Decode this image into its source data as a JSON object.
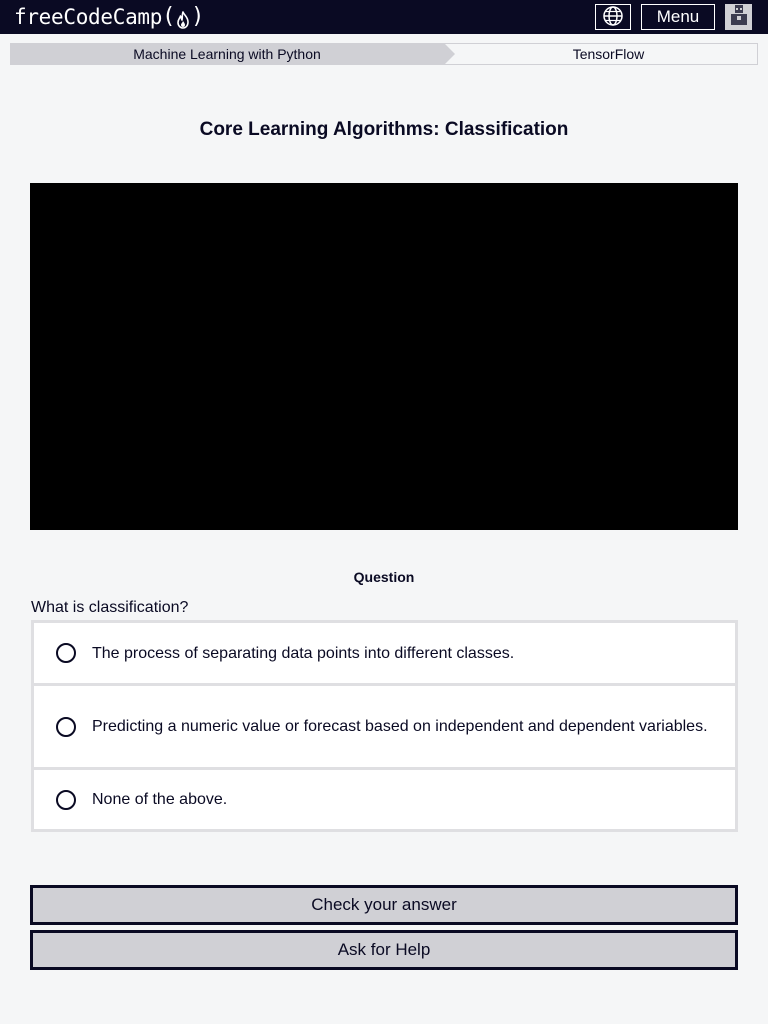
{
  "nav": {
    "logo_text": "freeCodeCamp",
    "logo_paren_open": "(",
    "logo_paren_close": ")",
    "logo_icon": "flame-icon",
    "language_icon": "globe-icon",
    "menu_label": "Menu",
    "avatar_icon": "avatar-icon"
  },
  "breadcrumb": {
    "course": "Machine Learning with Python",
    "lesson": "TensorFlow"
  },
  "title": "Core Learning Algorithms: Classification",
  "video": {
    "color": "#000000"
  },
  "question": {
    "heading": "Question",
    "text": "What is classification?",
    "answers": [
      {
        "label": "The process of separating data points into different classes.",
        "selected": false
      },
      {
        "label": "Predicting a numeric value or forecast based on independent and dependent variables.",
        "selected": false
      },
      {
        "label": "None of the above.",
        "selected": false
      }
    ]
  },
  "buttons": {
    "check": "Check your answer",
    "help": "Ask for Help"
  },
  "colors": {
    "nav_bg": "#0a0a23",
    "page_bg": "#f5f6f7",
    "button_bg": "#d0d0d5",
    "text": "#0a0a23"
  }
}
